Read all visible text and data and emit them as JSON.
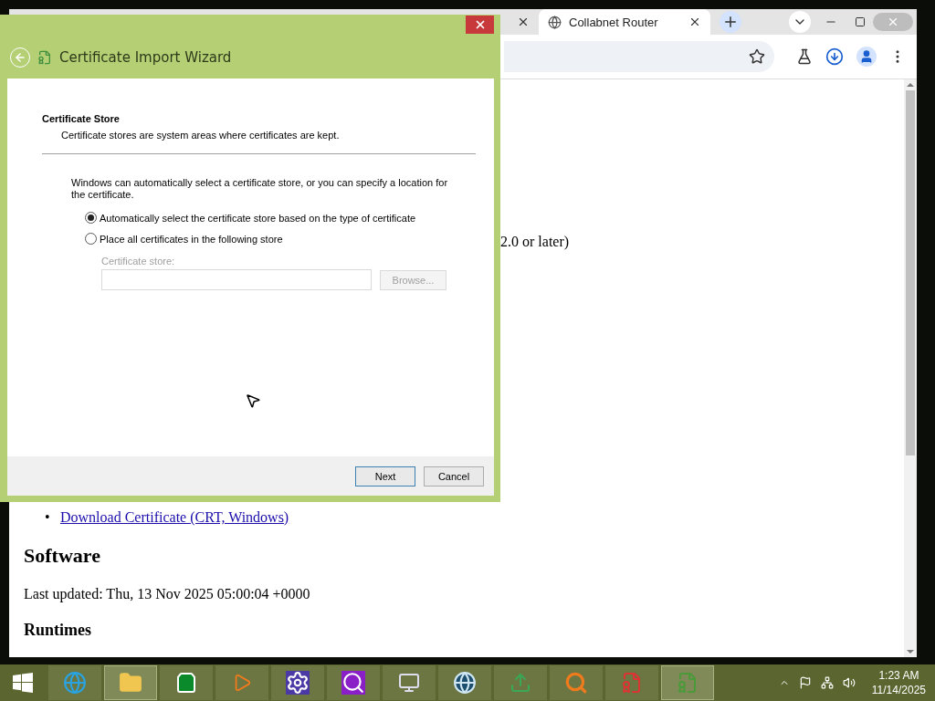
{
  "browser": {
    "tabs": [
      {
        "selected": false
      },
      {
        "title": "Collabnet Router",
        "selected": true
      }
    ],
    "page": {
      "fragment": "2.0 or later)",
      "links": [
        {
          "marker": "•",
          "text": "Download Certificate (CRT, Windows)"
        }
      ],
      "heading": "Software",
      "updated": "Last updated: Thu, 13 Nov 2025 05:00:04 +0000",
      "subheading": "Runtimes"
    }
  },
  "wizard": {
    "title": "Certificate Import Wizard",
    "section_title": "Certificate Store",
    "section_description": "Certificate stores are system areas where certificates are kept.",
    "intro": "Windows can automatically select a certificate store, or you can specify a location for the certificate.",
    "options": [
      {
        "label": "Automatically select the certificate store based on the type of certificate",
        "selected": true
      },
      {
        "label": "Place all certificates in the following store",
        "selected": false
      }
    ],
    "store_field": {
      "label": "Certificate store:",
      "disabled": true
    },
    "browse_button": {
      "label": "Browse...",
      "disabled": true
    },
    "buttons": [
      {
        "label": "Next",
        "default": true
      },
      {
        "label": "Cancel",
        "default": false
      }
    ]
  },
  "taskbar": {
    "apps": [
      {
        "kind": "ie",
        "active": false
      },
      {
        "kind": "explorer",
        "active": true
      },
      {
        "kind": "store",
        "active": false
      },
      {
        "kind": "media",
        "active": false
      },
      {
        "kind": "settings",
        "active": false
      },
      {
        "kind": "search",
        "active": false
      },
      {
        "kind": "monitor",
        "active": false
      },
      {
        "kind": "globe",
        "active": false
      },
      {
        "kind": "upload",
        "active": false
      },
      {
        "kind": "magnifier",
        "active": false
      },
      {
        "kind": "cert-error",
        "active": false
      },
      {
        "kind": "cert-import",
        "active": true
      }
    ],
    "clock": {
      "time": "1:23 AM",
      "date": "11/14/2025"
    }
  }
}
